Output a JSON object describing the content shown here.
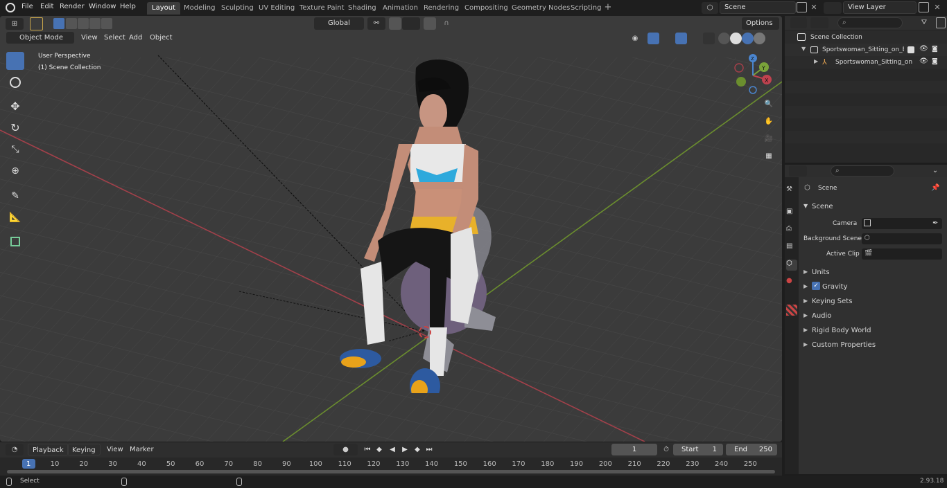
{
  "menu": {
    "file": "File",
    "edit": "Edit",
    "render": "Render",
    "window": "Window",
    "help": "Help"
  },
  "workspaces": [
    "Layout",
    "Modeling",
    "Sculpting",
    "UV Editing",
    "Texture Paint",
    "Shading",
    "Animation",
    "Rendering",
    "Compositing",
    "Geometry Nodes",
    "Scripting"
  ],
  "scene_field": "Scene",
  "view_layer_field": "View Layer",
  "viewport": {
    "mode": "Object Mode",
    "menus": [
      "View",
      "Select",
      "Add",
      "Object"
    ],
    "transform": "Global",
    "options": "Options",
    "overlay_title": "User Perspective",
    "overlay_sub": "(1) Scene Collection",
    "gizmo": {
      "x": "X",
      "y": "Y",
      "z": "Z"
    }
  },
  "outliner": {
    "root": "Scene Collection",
    "item1": "Sportswoman_Sitting_on_Bala",
    "item2": "Sportswoman_Sitting_on"
  },
  "properties": {
    "header": "Scene",
    "section": "Scene",
    "camera_label": "Camera",
    "bg_label": "Background Scene",
    "clip_label": "Active Clip",
    "panels": [
      "Units",
      "Gravity",
      "Keying Sets",
      "Audio",
      "Rigid Body World",
      "Custom Properties"
    ]
  },
  "timeline": {
    "menus": [
      "Playback",
      "Keying",
      "View",
      "Marker"
    ],
    "current_frame": "1",
    "start_label": "Start",
    "start": "1",
    "end_label": "End",
    "end": "250",
    "ticks": [
      "1",
      "10",
      "20",
      "30",
      "40",
      "50",
      "60",
      "70",
      "80",
      "90",
      "100",
      "110",
      "120",
      "130",
      "140",
      "150",
      "160",
      "170",
      "180",
      "190",
      "200",
      "210",
      "220",
      "230",
      "240",
      "250"
    ]
  },
  "status": {
    "select": "Select",
    "version": "2.93.18"
  },
  "colors": {
    "accent": "#4772b3",
    "x_axis": "#c0424f",
    "y_axis": "#7aa33a",
    "z_axis": "#4a85cf"
  }
}
